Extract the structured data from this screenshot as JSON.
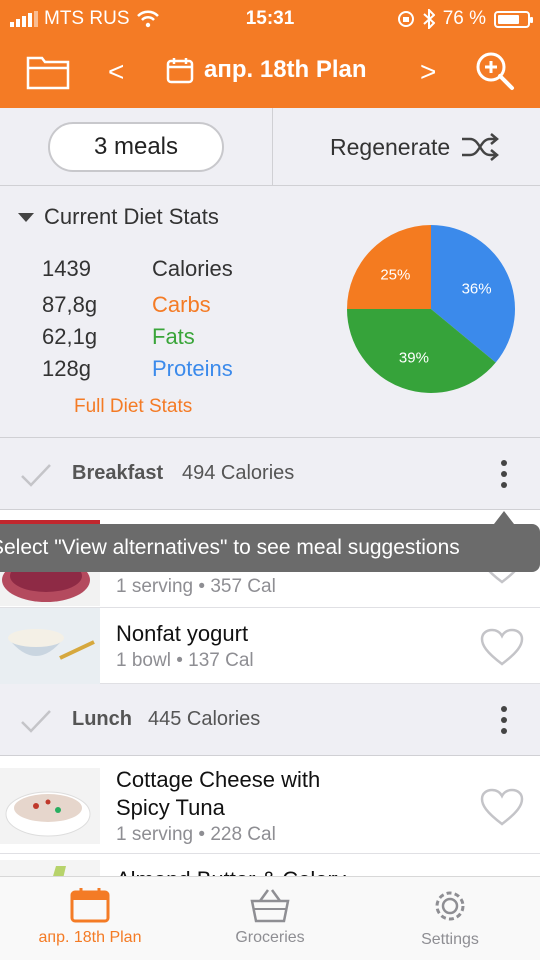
{
  "status_bar": {
    "carrier": "MTS RUS",
    "time": "15:31",
    "battery": "76 %",
    "battery_level": 0.76
  },
  "header": {
    "title": "апр. 18th Plan",
    "prev": "<",
    "next": ">",
    "icons": [
      "folder-icon",
      "calendar-icon",
      "zoom-in-icon"
    ]
  },
  "controls": {
    "meals": "3 meals",
    "regenerate": "Regenerate"
  },
  "diet_stats": {
    "heading": "Current Diet Stats",
    "rows": [
      {
        "value": "1439",
        "label": "Calories"
      },
      {
        "value": "87,8g",
        "label": "Carbs"
      },
      {
        "value": "62,1g",
        "label": "Fats"
      },
      {
        "value": "128g",
        "label": "Proteins"
      }
    ],
    "full_link": "Full Diet Stats",
    "colors": {
      "carbs": "#f47b25",
      "fats": "#3aa53a",
      "proteins": "#3b8aeb"
    }
  },
  "chart_data": {
    "type": "pie",
    "slices": [
      {
        "label": "Proteins",
        "percent": 36,
        "display": "36%",
        "color": "#3b8aeb"
      },
      {
        "label": "Fats",
        "percent": 39,
        "display": "39%",
        "color": "#36a33a"
      },
      {
        "label": "Carbs",
        "percent": 25,
        "display": "25%",
        "color": "#f47b20"
      }
    ]
  },
  "meals": [
    {
      "name": "Breakfast",
      "calories": "494 Calories",
      "items": [
        {
          "name": "",
          "serving": "1 serving",
          "cal": "357 Cal"
        },
        {
          "name": "Nonfat yogurt",
          "serving": "1 bowl",
          "cal": "137 Cal"
        }
      ]
    },
    {
      "name": "Lunch",
      "calories": "445 Calories",
      "items": [
        {
          "name_line1": "Cottage Cheese with",
          "name_line2": "Spicy Tuna",
          "serving": "1 serving",
          "cal": "228 Cal"
        },
        {
          "name": "Almond Butter & Celery"
        }
      ]
    }
  ],
  "tooltip": {
    "text": "Select \"View alternatives\" to see meal suggestions"
  },
  "tabbar": {
    "tabs": [
      {
        "label": "апр. 18th Plan",
        "active": true
      },
      {
        "label": "Groceries",
        "active": false
      },
      {
        "label": "Settings",
        "active": false
      }
    ],
    "active_color": "#f47b25",
    "inactive_color": "#8e8e93"
  }
}
